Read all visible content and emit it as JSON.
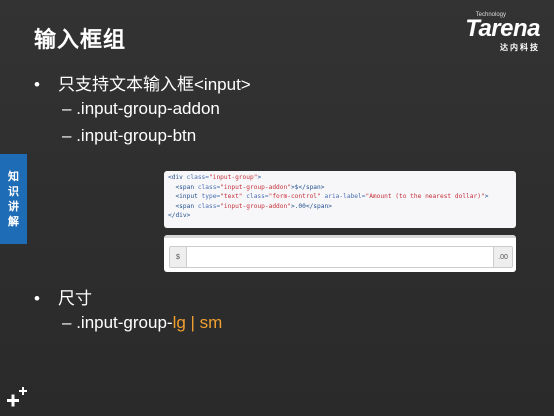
{
  "slide": {
    "title": "输入框组",
    "logo": {
      "word": "Tarena",
      "tech": "Technology",
      "cn": "达内科技"
    },
    "bullets": [
      {
        "text": "只支持文本输入框<input>",
        "subs": [
          ".input-group-addon",
          ".input-group-btn"
        ]
      },
      {
        "text": "尺寸",
        "sub_prefix": ".input-group-",
        "sub_highlight": "lg | sm"
      }
    ],
    "sidetab": [
      "知",
      "识",
      "讲",
      "解"
    ]
  },
  "code": {
    "line1_tag": "<div ",
    "line1_attr": "class=",
    "line1_str": "\"input-group\"",
    "line1_end": ">",
    "line2_tag": "  <span ",
    "line2_attr": "class=",
    "line2_str": "\"input-group-addon\"",
    "line2_end": ">$</span>",
    "line3_tag": "  <input ",
    "line3_attr1": "type=",
    "line3_str1": "\"text\"",
    "line3_attr2": " class=",
    "line3_str2": "\"form-control\"",
    "line3_attr3": " aria-label=",
    "line3_str3": "\"Amount (to the nearest dollar)\"",
    "line3_end": ">",
    "line4_tag": "  <span ",
    "line4_attr": "class=",
    "line4_str": "\"input-group-addon\"",
    "line4_end": ">.00</span>",
    "line5": "</div>"
  },
  "demo": {
    "left_addon": "$",
    "right_addon": ".00",
    "input_value": ""
  }
}
